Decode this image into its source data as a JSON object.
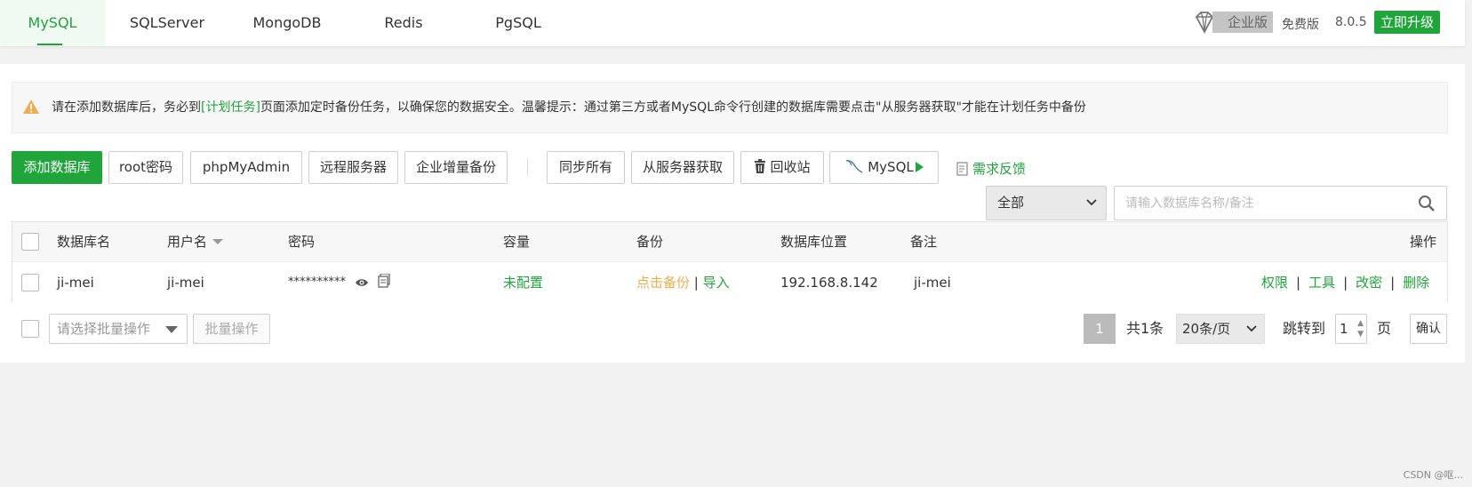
{
  "tabs": [
    {
      "label": "MySQL",
      "active": true
    },
    {
      "label": "SQLServer",
      "active": false
    },
    {
      "label": "MongoDB",
      "active": false
    },
    {
      "label": "Redis",
      "active": false
    },
    {
      "label": "PgSQL",
      "active": false
    }
  ],
  "header": {
    "enterprise_label": "企业版",
    "free_label": "免费版",
    "version": "8.0.5",
    "upgrade_label": "立即升级"
  },
  "alert": {
    "text_before": "请在添加数据库后，务必到",
    "link_text": "[计划任务]",
    "text_after": "页面添加定时备份任务，以确保您的数据安全。温馨提示：通过第三方或者MySQL命令行创建的数据库需要点击\"从服务器获取\"才能在计划任务中备份"
  },
  "toolbar": {
    "add_db": "添加数据库",
    "root_pw": "root密码",
    "phpmyadmin": "phpMyAdmin",
    "remote_server": "远程服务器",
    "incremental_backup": "企业增量备份",
    "sync_all": "同步所有",
    "fetch_from_server": "从服务器获取",
    "recycle_bin": "回收站",
    "mysql": "MySQL",
    "feedback": "需求反馈"
  },
  "filter": {
    "selected": "全部",
    "search_placeholder": "请输入数据库名称/备注"
  },
  "table": {
    "headers": {
      "name": "数据库名",
      "user": "用户名",
      "password": "密码",
      "capacity": "容量",
      "backup": "备份",
      "location": "数据库位置",
      "note": "备注",
      "actions": "操作"
    },
    "rows": [
      {
        "name": "ji-mei",
        "user": "ji-mei",
        "password": "**********",
        "capacity": "未配置",
        "backup_action": "点击备份",
        "backup_sep": "|",
        "import_action": "导入",
        "location": "192.168.8.142",
        "note": "ji-mei",
        "ops": [
          "权限",
          "工具",
          "改密",
          "删除"
        ],
        "op_sep": "|"
      }
    ]
  },
  "footer": {
    "batch_placeholder": "请选择批量操作",
    "batch_button": "批量操作",
    "current_page": "1",
    "total": "共1条",
    "page_size": "20条/页",
    "jump_label": "跳转到",
    "jump_value": "1",
    "page_unit": "页",
    "confirm": "确认"
  },
  "watermark": "CSDN @呕...",
  "colors": {
    "accent": "#20a53a",
    "warning": "#f0ad4e"
  }
}
